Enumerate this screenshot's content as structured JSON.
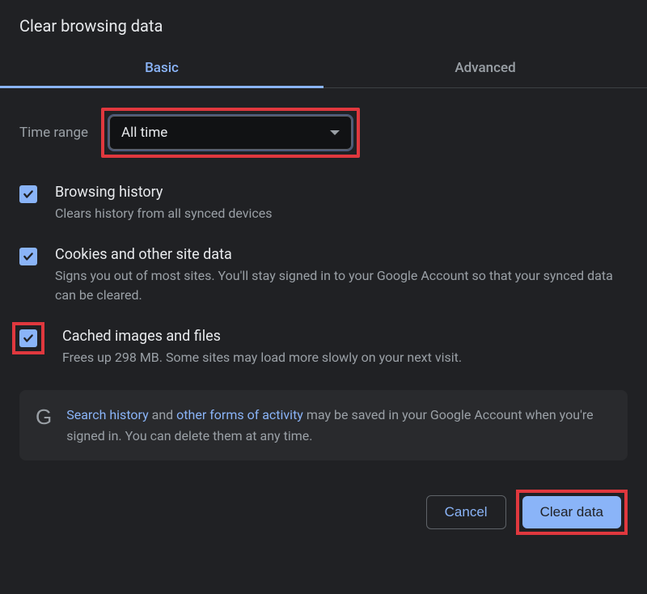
{
  "dialog": {
    "title": "Clear browsing data"
  },
  "tabs": {
    "basic": "Basic",
    "advanced": "Advanced"
  },
  "timeRange": {
    "label": "Time range",
    "value": "All time"
  },
  "options": {
    "browsingHistory": {
      "title": "Browsing history",
      "desc": "Clears history from all synced devices"
    },
    "cookies": {
      "title": "Cookies and other site data",
      "desc": "Signs you out of most sites. You'll stay signed in to your Google Account so that your synced data can be cleared."
    },
    "cached": {
      "title": "Cached images and files",
      "desc": "Frees up 298 MB. Some sites may load more slowly on your next visit."
    }
  },
  "info": {
    "link1": "Search history",
    "mid1": " and ",
    "link2": "other forms of activity",
    "rest": " may be saved in your Google Account when you're signed in. You can delete them at any time."
  },
  "actions": {
    "cancel": "Cancel",
    "clear": "Clear data"
  }
}
